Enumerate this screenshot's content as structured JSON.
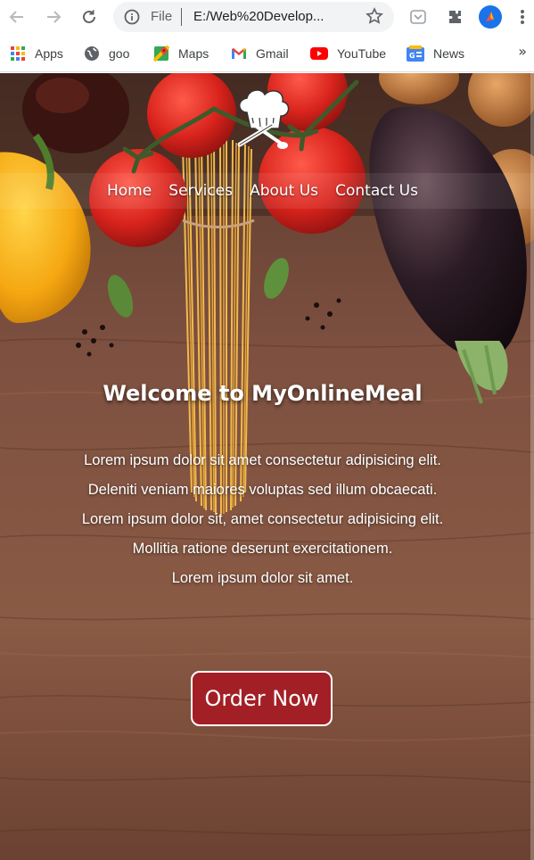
{
  "browser": {
    "scheme_label": "File",
    "url": "E:/Web%20Develop...",
    "icons": [
      "back-arrow-icon",
      "forward-arrow-icon",
      "reload-icon",
      "info-icon",
      "star-icon",
      "pocket-icon",
      "extensions-icon",
      "profile-icon",
      "menu-icon"
    ]
  },
  "bookmarks": {
    "items": [
      {
        "label": "Apps",
        "icon": "apps-grid-icon"
      },
      {
        "label": "goo",
        "icon": "globe-icon"
      },
      {
        "label": "Maps",
        "icon": "maps-icon"
      },
      {
        "label": "Gmail",
        "icon": "gmail-icon"
      },
      {
        "label": "YouTube",
        "icon": "youtube-icon"
      },
      {
        "label": "News",
        "icon": "news-icon"
      }
    ],
    "more": "»"
  },
  "site": {
    "nav": [
      "Home",
      "Services",
      "About Us",
      "Contact Us"
    ],
    "hero": {
      "title": "Welcome to MyOnlineMeal",
      "paragraphs": [
        "Lorem ipsum dolor sit amet consectetur adipisicing elit. Deleniti veniam maiores voluptas sed illum obcaecati.",
        "Lorem ipsum dolor sit, amet consectetur adipisicing elit. Mollitia ratione deserunt exercitationem.",
        "Lorem ipsum dolor sit amet."
      ],
      "cta": "Order Now"
    }
  },
  "colors": {
    "accent": "#a31f26",
    "wood": "#7a4a35",
    "text": "#ffffff"
  }
}
